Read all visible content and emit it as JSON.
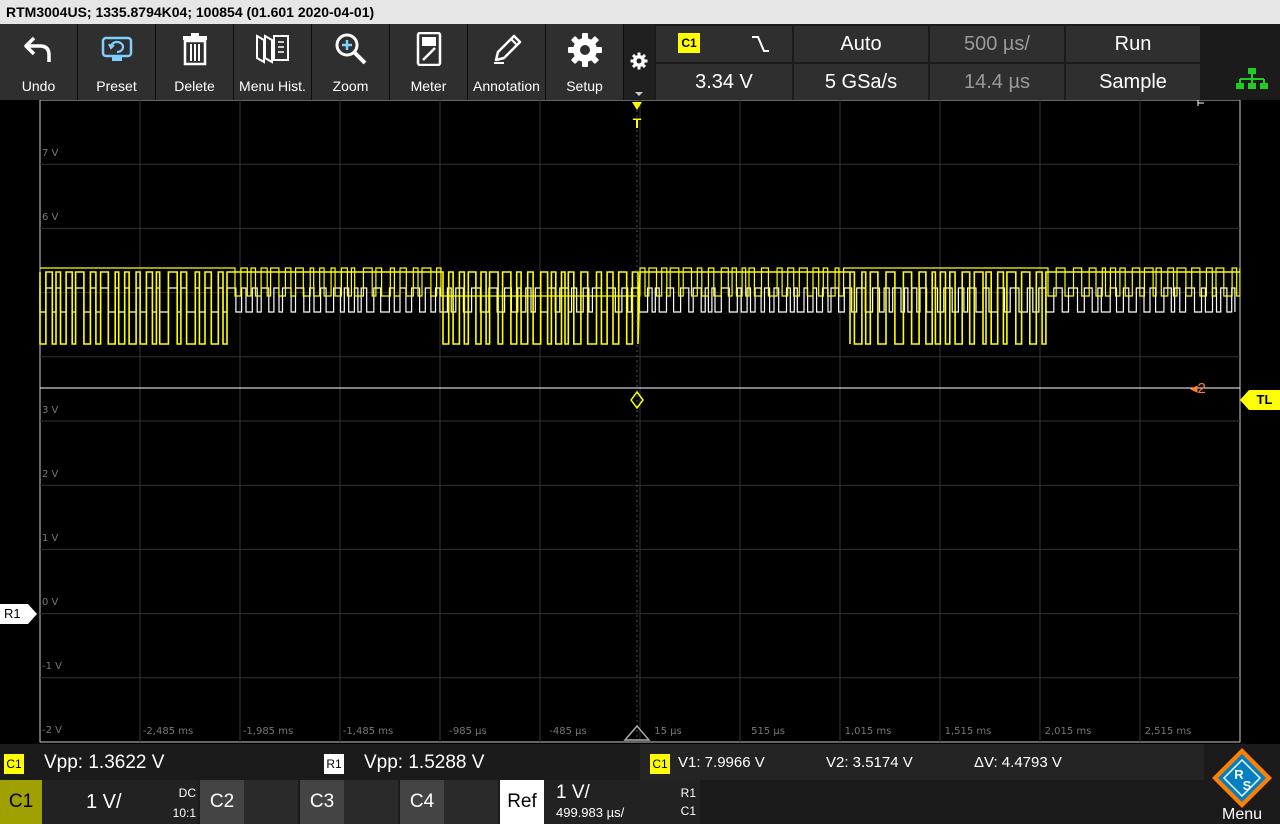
{
  "title": "RTM3004US; 1335.8794K04; 100854 (01.601 2020-04-01)",
  "toolbar": {
    "undo": "Undo",
    "preset": "Preset",
    "delete": "Delete",
    "menu_hist": "Menu Hist.",
    "zoom": "Zoom",
    "meter": "Meter",
    "annotation": "Annotation",
    "setup": "Setup"
  },
  "status": {
    "trigger_source": "C1",
    "trigger_level": "3.34 V",
    "trigger_mode": "Auto",
    "sample_rate": "5 GSa/s",
    "timebase": "500 µs/",
    "trigger_offset": "14.4 µs",
    "run_state": "Run",
    "acq_mode": "Sample"
  },
  "grid": {
    "y_labels": [
      "7 V",
      "6 V",
      "3 V",
      "2 V",
      "1 V",
      "0 V",
      "-1 V",
      "-2 V"
    ],
    "x_labels": [
      "-2,485 ms",
      "-1,985 ms",
      "-1,485 ms",
      "-985 µs",
      "-485 µs",
      "15 µs",
      "515 µs",
      "1,015 ms",
      "1,515 ms",
      "2,015 ms",
      "2,515 ms"
    ],
    "trigger_marker": "T",
    "trigger_level_marker": "TL",
    "ref_marker": "R1",
    "ref_index": "2"
  },
  "measurements": {
    "c1_badge": "C1",
    "c1_vpp": "Vpp: 1.3622 V",
    "r1_badge": "R1",
    "r1_vpp": "Vpp: 1.5288 V",
    "cursor_badge": "C1",
    "v1": "V1: 7.9966 V",
    "v2": "V2: 3.5174 V",
    "dv": "ΔV: 4.4793 V"
  },
  "channels": {
    "c1_label": "C1",
    "c1_scale": "1 V/",
    "c1_coupling": "DC",
    "c1_probe": "10:1",
    "c2_label": "C2",
    "c3_label": "C3",
    "c4_label": "C4",
    "ref_label": "Ref",
    "ref_scale": "1 V/",
    "ref_time": "499.983 µs/",
    "ref_slot": "R1",
    "ref_source": "C1"
  },
  "menu_label": "Menu",
  "colors": {
    "channel1": "#ffff00",
    "reference": "#ffffff",
    "ref_marker": "#ff7f27"
  }
}
